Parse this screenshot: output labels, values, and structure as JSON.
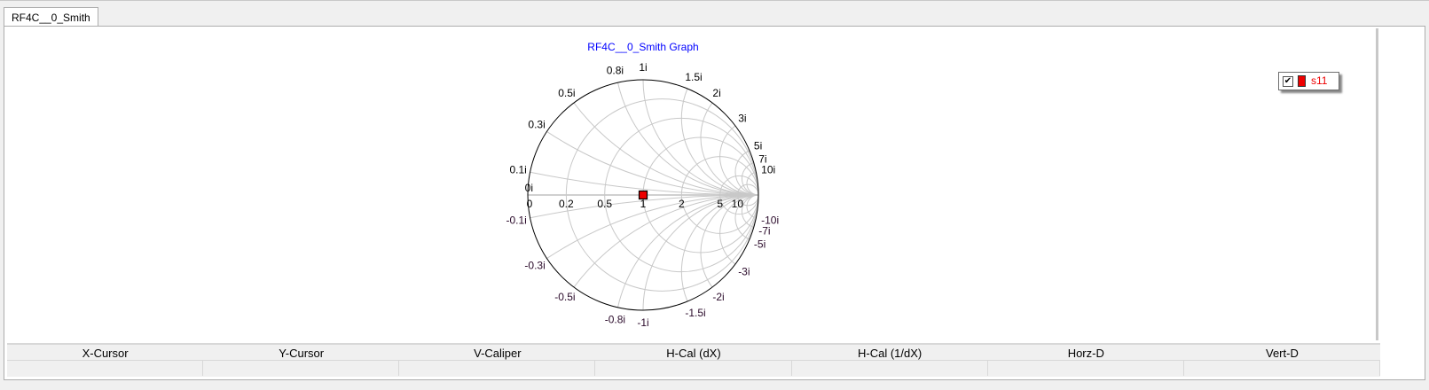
{
  "tabs": [
    {
      "label": "RF4C__0_Smith",
      "active": true
    }
  ],
  "legend": {
    "items": [
      {
        "label": "s11",
        "checked": true,
        "color": "#ee0000"
      }
    ]
  },
  "statusbar": {
    "headers": [
      "X-Cursor",
      "Y-Cursor",
      "V-Caliper",
      "H-Cal (dX)",
      "H-Cal (1/dX)",
      "Horz-D",
      "Vert-D"
    ],
    "values": [
      "",
      "",
      "",
      "",
      "",
      "",
      ""
    ]
  },
  "chart_data": {
    "type": "smith",
    "title": "RF4C__0_Smith Graph",
    "title_color": "#0000ff",
    "resistance_values": [
      0,
      0.2,
      0.5,
      1,
      2,
      5,
      10
    ],
    "resistance_labels": [
      "0",
      "0.2",
      "0.5",
      "1",
      "2",
      "5",
      "10"
    ],
    "reactance_values": [
      0,
      0.1,
      0.3,
      0.5,
      0.8,
      1,
      1.5,
      2,
      3,
      5,
      7,
      10,
      -0.1,
      -0.3,
      -0.5,
      -0.8,
      -1,
      -1.5,
      -2,
      -3,
      -5,
      -7,
      -10
    ],
    "reactance_labels": [
      "0i",
      "0.1i",
      "0.3i",
      "0.5i",
      "0.8i",
      "1i",
      "1.5i",
      "2i",
      "3i",
      "5i",
      "7i",
      "10i",
      "-0.1i",
      "-0.3i",
      "-0.5i",
      "-0.8i",
      "-1i",
      "-1.5i",
      "-2i",
      "-3i",
      "-5i",
      "-7i",
      "-10i"
    ],
    "series": [
      {
        "name": "s11",
        "color": "#ee0000",
        "points": [
          {
            "r": 1,
            "x": 0
          }
        ]
      }
    ]
  }
}
